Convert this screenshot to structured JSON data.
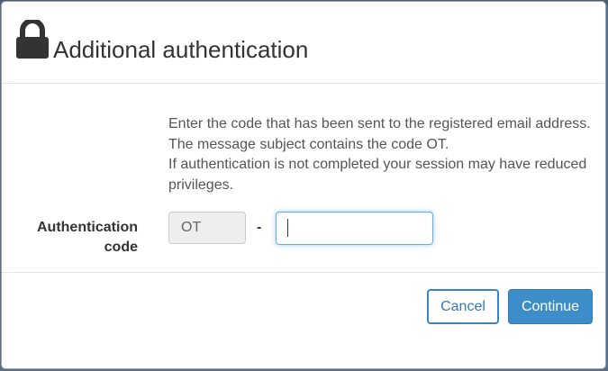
{
  "dialog": {
    "title": "Additional authentication",
    "icon": "lock-icon"
  },
  "info": {
    "line1": "Enter the code that has been sent to the registered email address.",
    "line2": "The message subject contains the code OT.",
    "line3": "If authentication is not completed your session may have reduced privileges."
  },
  "auth_field": {
    "label": "Authentication code",
    "prefix": "OT",
    "separator": "-",
    "value": "",
    "placeholder": ""
  },
  "buttons": {
    "cancel": "Cancel",
    "continue": "Continue"
  },
  "colors": {
    "primary": "#3c8dc8",
    "focus_border": "#66afe9",
    "link": "#337ab7"
  }
}
